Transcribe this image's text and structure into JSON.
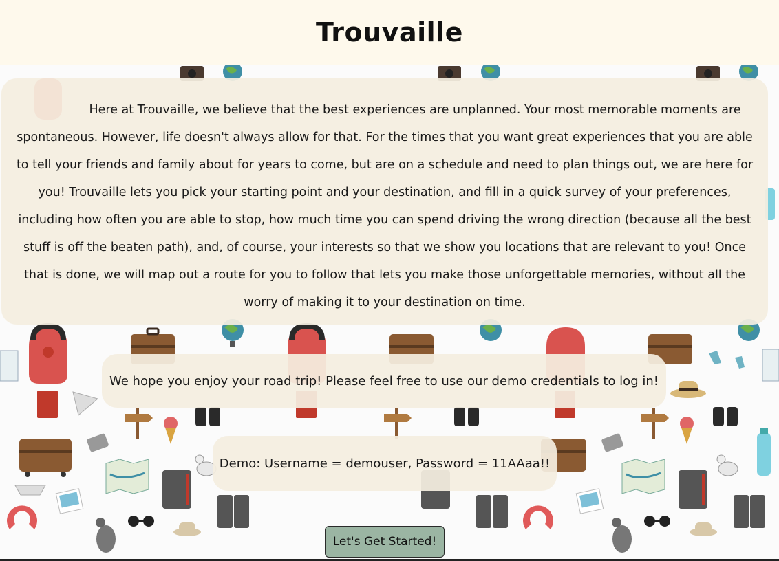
{
  "header": {
    "title": "Trouvaille"
  },
  "intro": {
    "text": "Here at Trouvaille, we believe that the best experiences are unplanned. Your most memorable moments are spontaneous. However, life doesn't always allow for that. For the times that you want great experiences that you are able to tell your friends and family about for years to come, but are on a schedule and need to plan things out, we are here for you! Trouvaille lets you pick your starting point and your destination, and fill in a quick survey of your preferences, including how often you are able to stop, how much time you can spend driving the wrong direction (because all the best stuff is off the beaten path), and, of course, your interests so that we show you locations that are relevant to you! Once that is done, we will map out a route for you to follow that lets you make those unforgettable memories, without all the worry of making it to your destination on time."
  },
  "hope": {
    "text": "We hope you enjoy your road trip! Please feel free to use our demo credentials to log in!"
  },
  "demo": {
    "text": "Demo: Username = demouser, Password = 11AAaa!!"
  },
  "cta": {
    "label": "Let's Get Started!"
  },
  "colors": {
    "header_bg": "#fef9ec",
    "panel_bg": "#f4eee0",
    "button_bg": "#9bb5a3",
    "pattern_bg": "#fbfbfb"
  },
  "background_icons": [
    "backpack-icon",
    "suitcase-icon",
    "globe-icon",
    "camera-icon",
    "passport-icon",
    "paper-plane-icon",
    "signpost-icon",
    "ice-cream-icon",
    "binoculars-icon",
    "map-icon",
    "notebook-icon",
    "seagull-icon",
    "pigeon-icon",
    "neck-pillow-icon",
    "sunglasses-icon",
    "hat-icon",
    "sneakers-icon",
    "water-bottle-icon",
    "ticket-icon",
    "paper-boat-icon",
    "photo-icon"
  ]
}
